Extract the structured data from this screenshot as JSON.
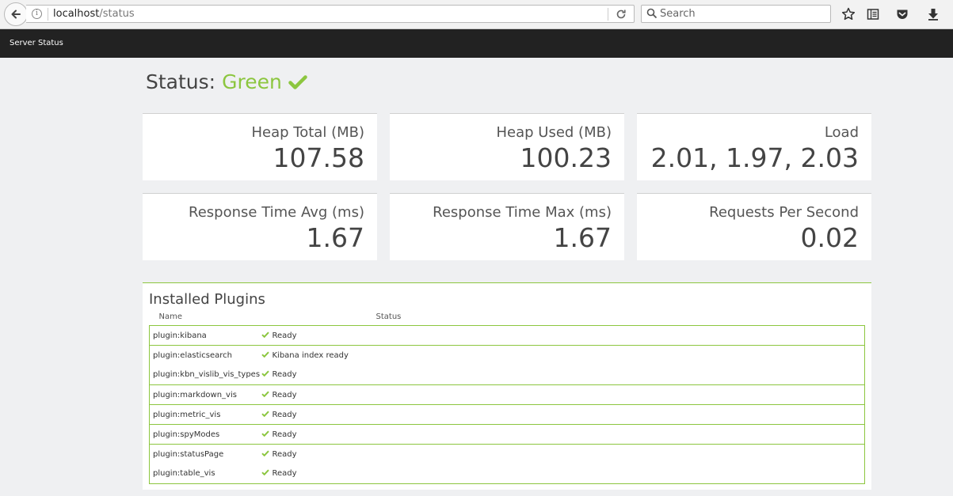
{
  "browser": {
    "url_host": "localhost",
    "url_path": "/status",
    "search_placeholder": "Search"
  },
  "nav": {
    "brand": "Server Status"
  },
  "status": {
    "label": "Status:",
    "state": "Green",
    "state_color": "#8cc63f"
  },
  "metrics": [
    {
      "label": "Heap Total (MB)",
      "value": "107.58"
    },
    {
      "label": "Heap Used (MB)",
      "value": "100.23"
    },
    {
      "label": "Load",
      "value": "2.01, 1.97, 2.03"
    },
    {
      "label": "Response Time Avg (ms)",
      "value": "1.67"
    },
    {
      "label": "Response Time Max (ms)",
      "value": "1.67"
    },
    {
      "label": "Requests Per Second",
      "value": "0.02"
    }
  ],
  "plugins": {
    "title": "Installed Plugins",
    "columns": {
      "name": "Name",
      "status": "Status"
    },
    "rows": [
      {
        "name": "plugin:kibana",
        "status": "Ready"
      },
      {
        "name": "plugin:elasticsearch",
        "status": "Kibana index ready"
      },
      {
        "name": "plugin:kbn_vislib_vis_types",
        "status": "Ready"
      },
      {
        "name": "plugin:markdown_vis",
        "status": "Ready"
      },
      {
        "name": "plugin:metric_vis",
        "status": "Ready"
      },
      {
        "name": "plugin:spyModes",
        "status": "Ready"
      },
      {
        "name": "plugin:statusPage",
        "status": "Ready"
      },
      {
        "name": "plugin:table_vis",
        "status": "Ready"
      }
    ]
  }
}
